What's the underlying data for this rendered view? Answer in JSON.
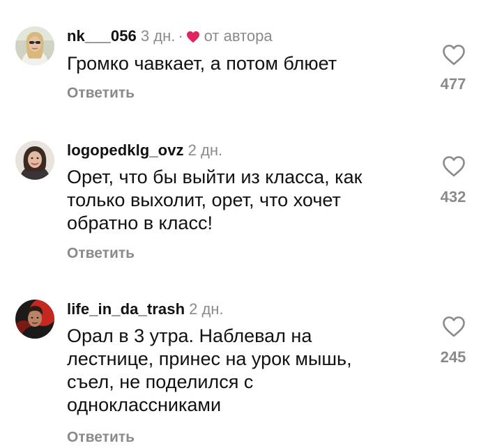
{
  "comments": [
    {
      "username": "nk___056",
      "time": "3 дн.",
      "separator": "·",
      "author_note": "от автора",
      "text": "Громко чавкает, а потом блюет",
      "reply_label": "Ответить",
      "likes": "477",
      "avatar_icon": "avatar-woman-sunglasses",
      "heart_color": "#e0245e"
    },
    {
      "username": "logopedklg_ovz",
      "time": "2 дн.",
      "text": "Орет, что бы выйти из класса, как только выхолит, орет, что хочет обратно в класс!",
      "reply_label": "Ответить",
      "likes": "432",
      "avatar_icon": "avatar-woman-dark-hair"
    },
    {
      "username": "life_in_da_trash",
      "time": "2 дн.",
      "text": "Орал в 3 утра. Наблевал на лестнице, принес на урок мышь, съел, не поделился с одноклассниками",
      "reply_label": "Ответить",
      "likes": "245",
      "avatar_icon": "avatar-man-red-background"
    }
  ],
  "icons": {
    "like": "heart-outline-icon",
    "author_like": "heart-filled-icon"
  }
}
